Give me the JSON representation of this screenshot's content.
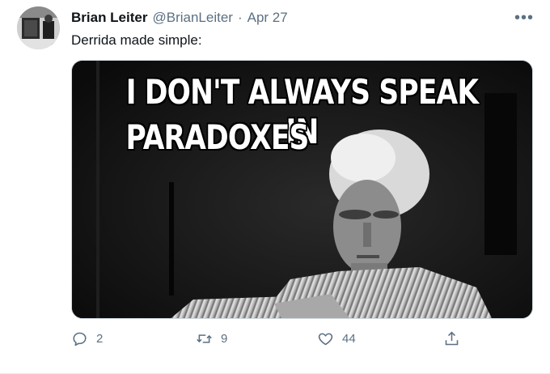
{
  "tweet": {
    "author_name": "Brian Leiter",
    "author_handle": "@BrianLeiter",
    "separator": "·",
    "date": "Apr 27",
    "text": "Derrida made simple:",
    "more_label": "•••",
    "media": {
      "caption_line1": "I DON'T ALWAYS SPEAK IN",
      "caption_line2": "PARADOXES"
    },
    "actions": {
      "reply_count": "2",
      "retweet_count": "9",
      "like_count": "44"
    }
  },
  "icons": {
    "reply": "reply-icon",
    "retweet": "retweet-icon",
    "like": "heart-icon",
    "share": "share-icon",
    "more": "more-icon"
  },
  "colors": {
    "text_primary": "#0f1419",
    "text_secondary": "#5b7083",
    "border": "#e6ecf0"
  }
}
